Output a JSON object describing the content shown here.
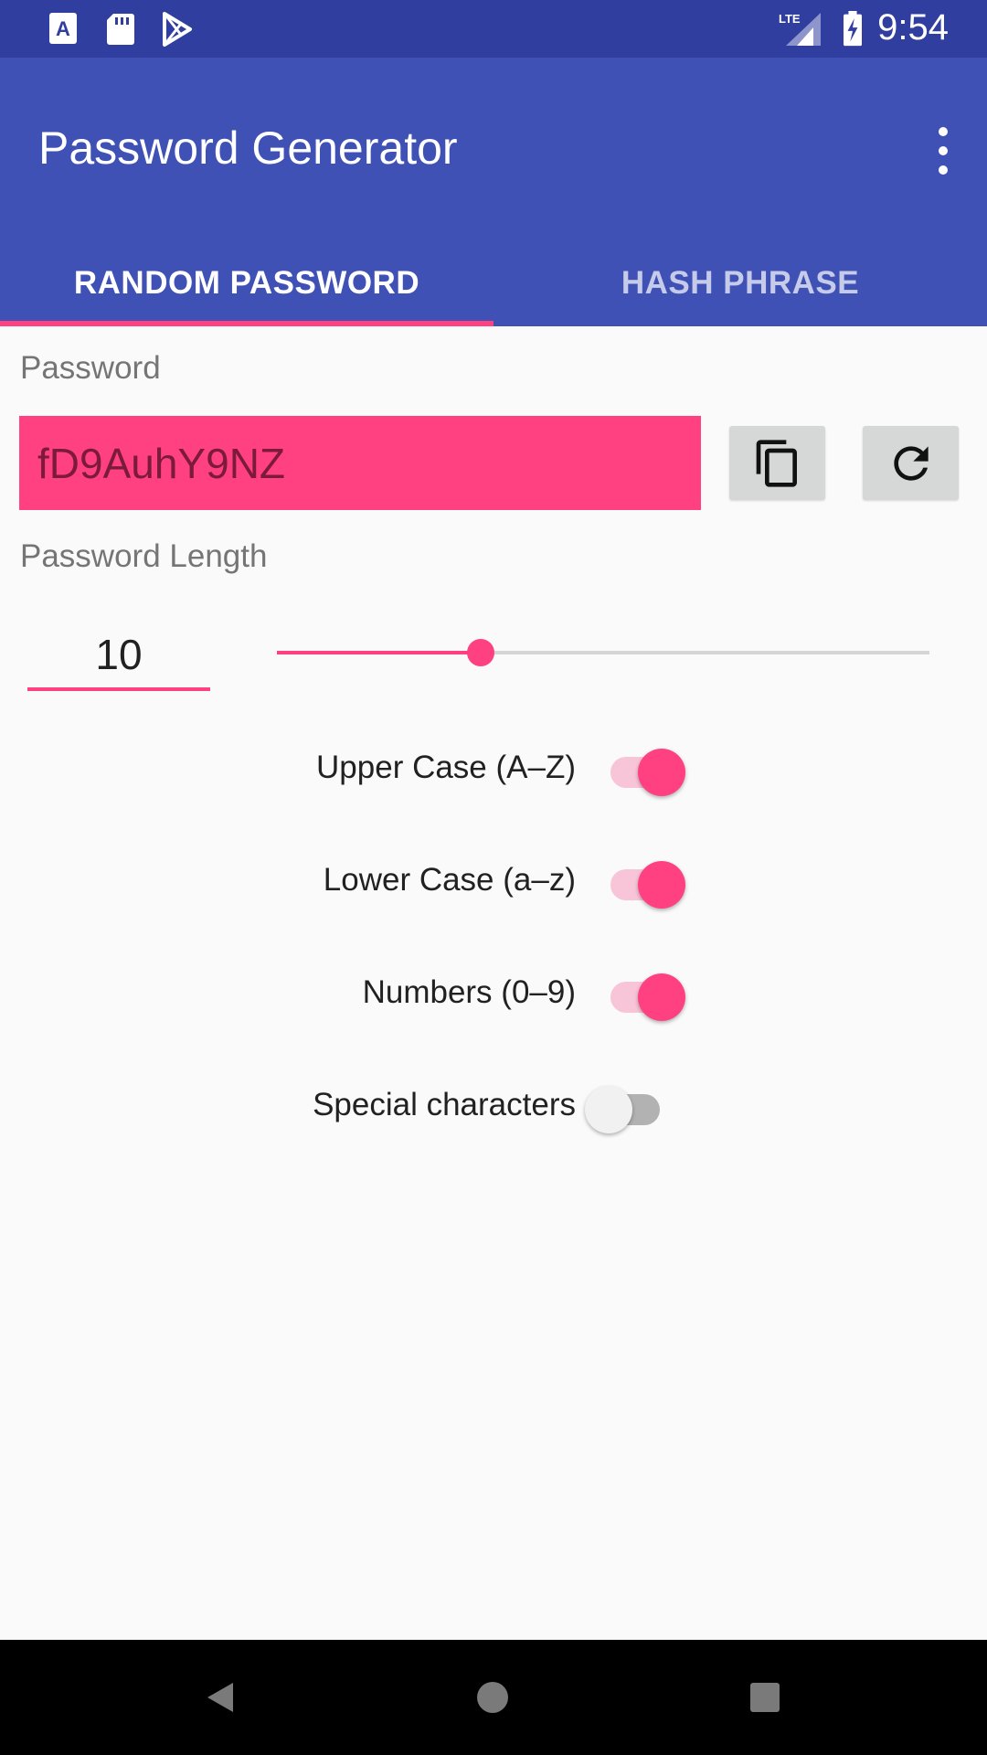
{
  "status_bar": {
    "time": "9:54",
    "icons": [
      "a-notification-icon",
      "sd-card-icon",
      "play-store-icon",
      "lte-signal-icon",
      "battery-charging-icon"
    ]
  },
  "app_bar": {
    "title": "Password Generator",
    "overflow_icon": "more-vert-icon"
  },
  "tabs": [
    {
      "label": "RANDOM PASSWORD",
      "active": true
    },
    {
      "label": "HASH PHRASE",
      "active": false
    }
  ],
  "password": {
    "label": "Password",
    "value": "fD9AuhY9NZ",
    "copy_icon": "copy-icon",
    "refresh_icon": "refresh-icon"
  },
  "length": {
    "label": "Password Length",
    "value": "10",
    "slider_fraction": 0.312
  },
  "options": [
    {
      "label": "Upper Case (A–Z)",
      "checked": true
    },
    {
      "label": "Lower Case (a–z)",
      "checked": true
    },
    {
      "label": "Numbers (0–9)",
      "checked": true
    },
    {
      "label": "Special characters",
      "checked": false
    }
  ],
  "colors": {
    "primary": "#3f51b5",
    "primary_dark": "#303f9f",
    "accent": "#ff4081"
  },
  "nav_bar": [
    "back-icon",
    "home-icon",
    "recents-icon"
  ]
}
